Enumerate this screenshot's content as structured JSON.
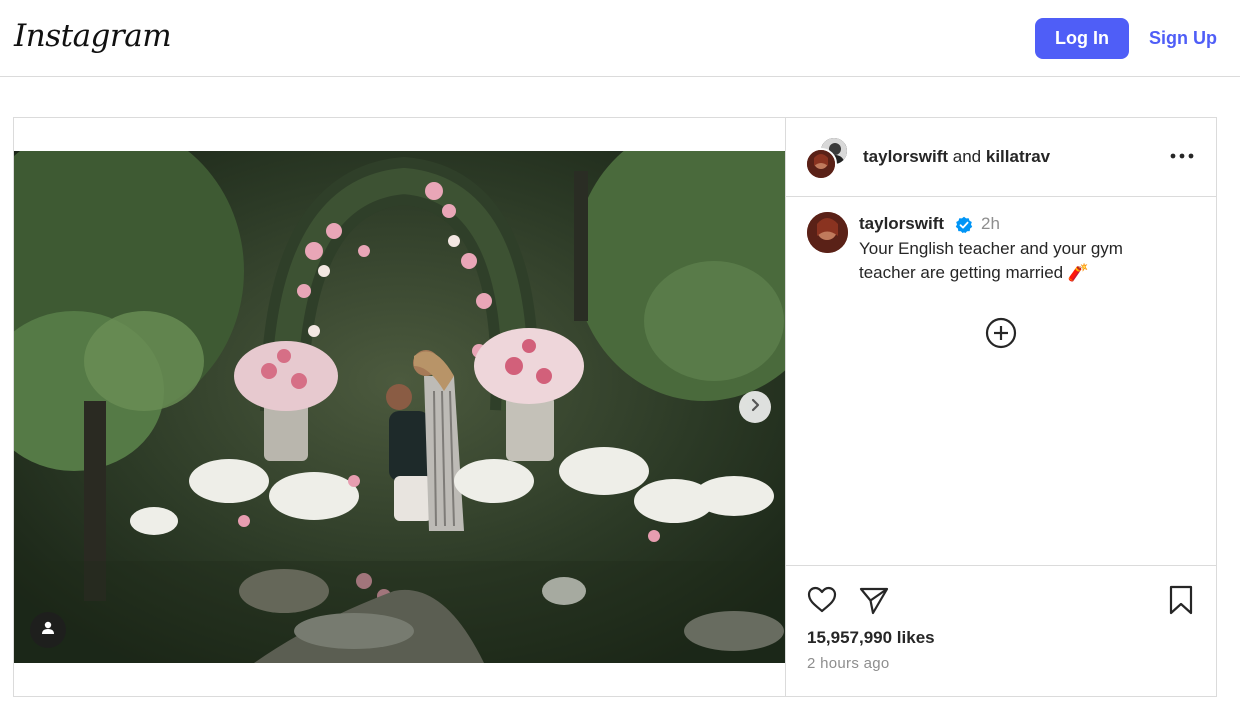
{
  "header": {
    "logo_text": "Instagram",
    "login_label": "Log In",
    "signup_label": "Sign Up",
    "accent_color": "#4f5ef7"
  },
  "post": {
    "image_icon_names": [
      "chevron-right-icon",
      "user-tag-icon"
    ],
    "header": {
      "author": "taylorswift",
      "conjunction": "and",
      "collaborator": "killatrav",
      "more_icon": "more-horizontal-icon"
    },
    "caption": {
      "username": "taylorswift",
      "verified_icon": "verified-badge-icon",
      "time": "2h",
      "text": "Your English teacher and your gym teacher are getting married 🧨",
      "add_icon": "plus-circle-icon"
    },
    "actions": {
      "like_icon": "heart-icon",
      "share_icon": "send-icon",
      "save_icon": "bookmark-icon"
    },
    "likes_text": "15,957,990 likes",
    "posted_ago": "2 hours ago"
  }
}
